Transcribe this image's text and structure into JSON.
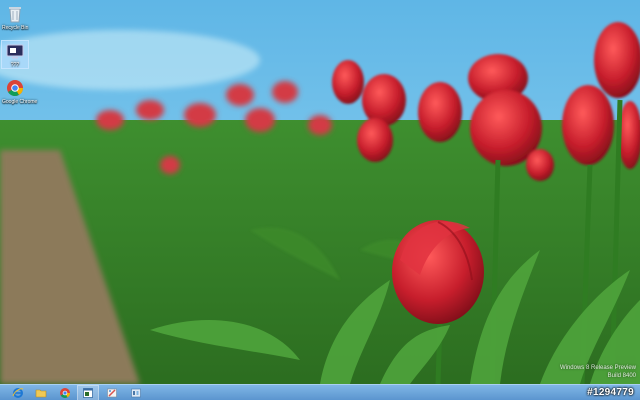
{
  "desktop": {
    "icons": [
      {
        "label": "Recycle Bin",
        "icon": "recycle-bin-icon"
      },
      {
        "label": "???",
        "icon": "monitor-app-icon"
      },
      {
        "label": "Google Chrome",
        "icon": "chrome-icon"
      }
    ]
  },
  "watermark": {
    "line1": "Windows 8 Release Preview",
    "line2": "Build 8400"
  },
  "stamp": "#1294779",
  "taskbar": {
    "buttons": [
      {
        "icon": "internet-explorer-icon"
      },
      {
        "icon": "file-explorer-icon"
      },
      {
        "icon": "chrome-icon"
      },
      {
        "icon": "app-window-icon"
      },
      {
        "icon": "paint-icon"
      },
      {
        "icon": "control-panel-icon"
      }
    ]
  },
  "colors": {
    "taskbar": "#6aa5dc",
    "sky": "#7fc6ea",
    "tulip_red": "#c8202d",
    "leaf_green": "#3f8d2b"
  }
}
